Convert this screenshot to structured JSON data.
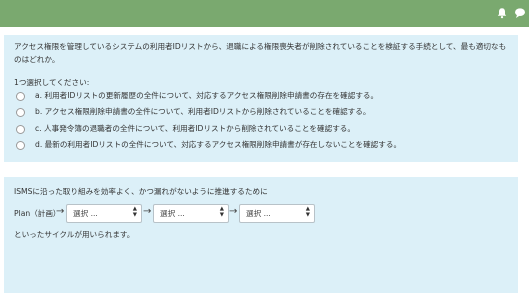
{
  "quiz": {
    "question": "アクセス権限を管理しているシステムの利用者IDリストから、退職による権限喪失者が削除されていることを検証する手続として、最も適切なものはどれか。",
    "instruction": "1つ選択してください:",
    "options": [
      {
        "label": "a. 利用者IDリストの更新履歴の全件について、対応するアクセス権限削除申請書の存在を確認する。"
      },
      {
        "label": "b. アクセス権限削除申請書の全件について、利用者IDリストから削除されていることを確認する。"
      },
      {
        "label": "c. 人事発令簿の退職者の全件について、利用者IDリストから削除されていることを確認する。"
      },
      {
        "label": "d. 最新の利用者IDリストの全件について、対応するアクセス権限削除申請書が存在しないことを確認する。"
      }
    ]
  },
  "cycle": {
    "intro": "ISMSに沿った取り組みを効率よく、かつ漏れがないように推進するために",
    "plan_label": "Plan（計画）",
    "arrow": "→",
    "selects": [
      {
        "value": "選択 ..."
      },
      {
        "value": "選択 ..."
      },
      {
        "value": "選択 ..."
      }
    ],
    "caret": "▲▼",
    "ending": "といったサイクルが用いられます。"
  },
  "icons": {
    "bell": "bell-icon",
    "chat": "chat-icon"
  },
  "colors": {
    "topbar": "#7aa96f",
    "panel": "#dcf0f8"
  }
}
